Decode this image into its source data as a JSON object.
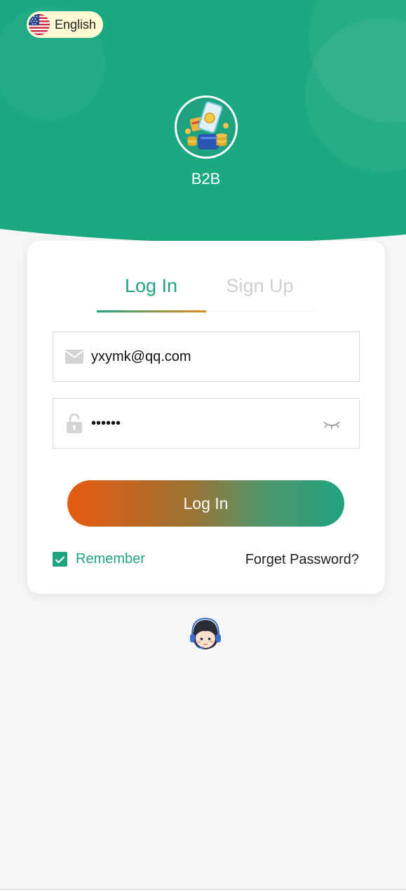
{
  "language": {
    "label": "English",
    "flag_icon": "us-flag-icon"
  },
  "app": {
    "name": "B2B",
    "logo_icon": "phone-coins-logo"
  },
  "tabs": [
    {
      "label": "Log In",
      "active": true
    },
    {
      "label": "Sign Up",
      "active": false
    }
  ],
  "form": {
    "email_value": "yxymk@qq.com",
    "email_icon": "mail-icon",
    "password_value": "yxymk1",
    "password_icon": "lock-icon",
    "password_toggle_icon": "eye-closed-icon",
    "submit_label": "Log In",
    "remember_label": "Remember",
    "remember_checked": true,
    "forgot_label": "Forget Password?"
  },
  "support": {
    "icon": "customer-service-icon"
  },
  "colors": {
    "primary": "#1fa37f",
    "accent": "#e85a10",
    "page_bg": "#f6f6f6",
    "language_pill": "#fdfbd3"
  }
}
